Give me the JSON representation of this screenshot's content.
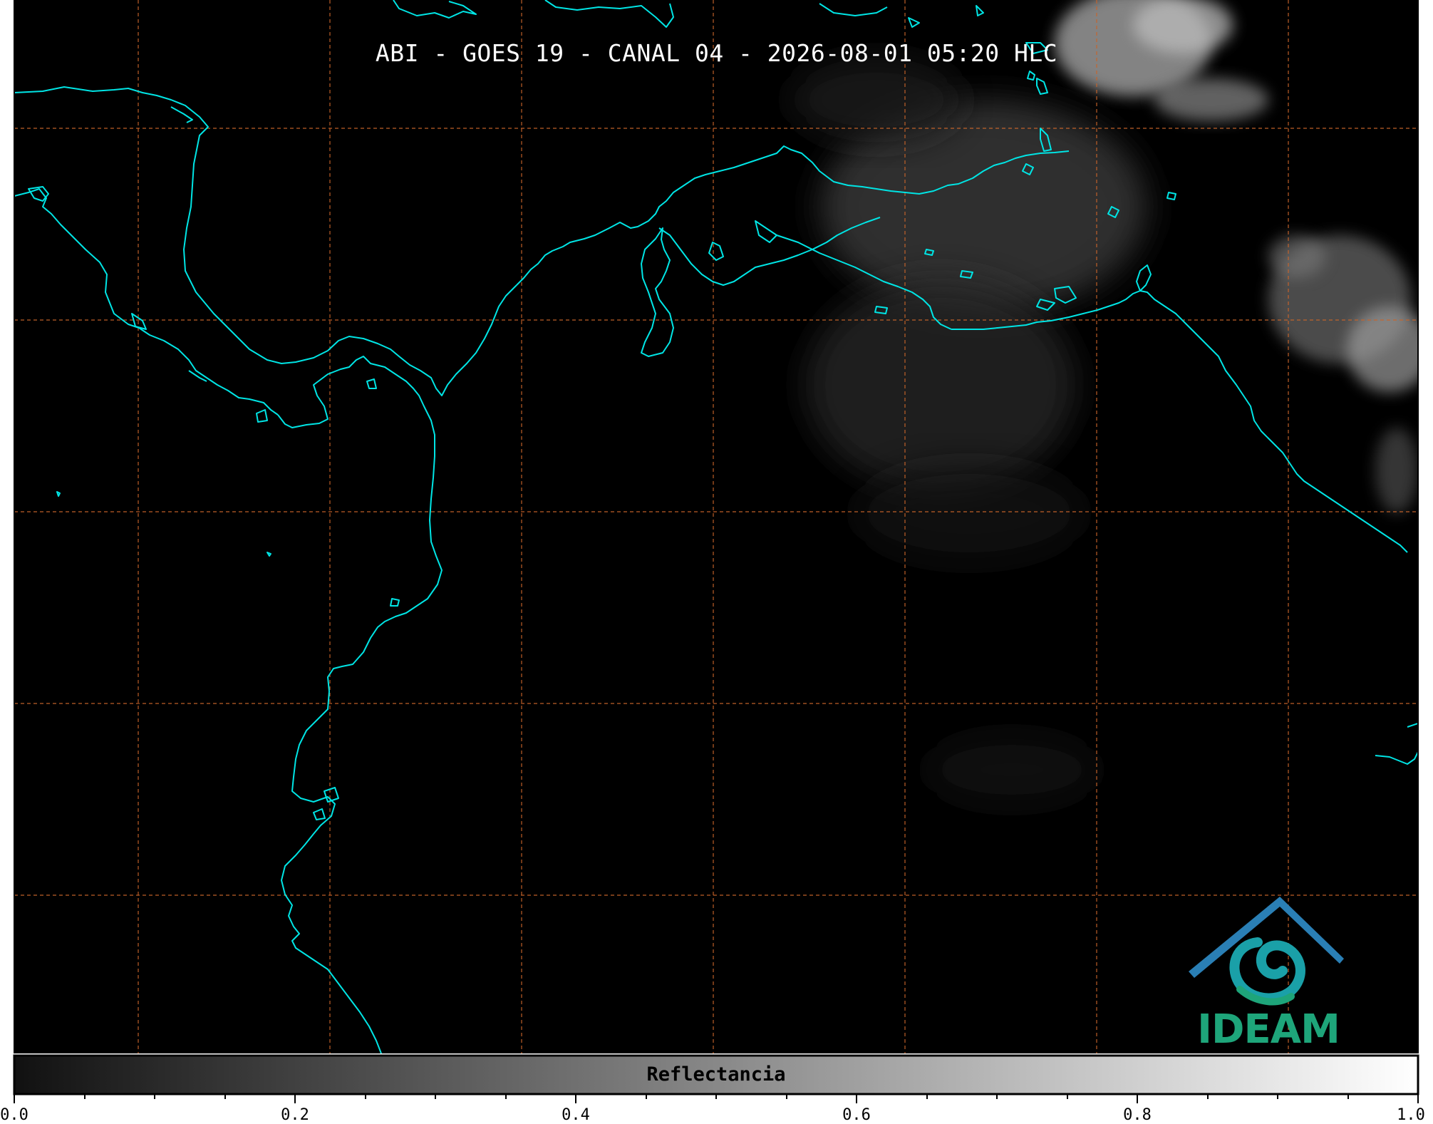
{
  "title": "ABI - GOES 19 - CANAL 04 - 2026-08-01 05:20 HLC",
  "logo": {
    "name": "IDEAM",
    "colors": {
      "teal": "#1ea57a",
      "blue": "#2a6fb5",
      "cyan": "#1aa0b0"
    }
  },
  "colorbar": {
    "label": "Reflectancia",
    "ticks": [
      "0.0",
      "0.2",
      "0.4",
      "0.6",
      "0.8",
      "1.0"
    ],
    "range": [
      0.0,
      1.0
    ],
    "colormap": "grayscale"
  },
  "map": {
    "background": "#000000",
    "coastline_color": "#00e5e5",
    "grid_color": "#c8642a",
    "grid_style": "dashed"
  }
}
